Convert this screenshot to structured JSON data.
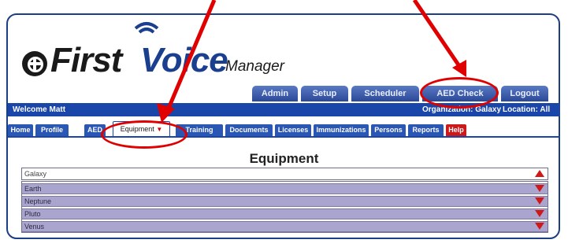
{
  "logo": {
    "first": "First",
    "voice": "Voice",
    "manager": "Manager"
  },
  "nav": {
    "buttons": [
      "Admin",
      "Setup",
      "Scheduler",
      "AED Check",
      "Logout"
    ]
  },
  "status": {
    "welcome": "Welcome Matt",
    "organization": "Organization: Galaxy",
    "location": "Location: All"
  },
  "tabs": [
    "Home",
    "Profile",
    "AED",
    "Equipment",
    "Training",
    "Documents",
    "Licenses",
    "Immunizations",
    "Persons",
    "Reports",
    "Help"
  ],
  "active_tab": "Equipment",
  "main": {
    "title": "Equipment",
    "group": "Galaxy",
    "items": [
      "Earth",
      "Neptune",
      "Pluto",
      "Venus"
    ]
  },
  "colors": {
    "annotation": "#e00000",
    "nav_blue": "#1946a8",
    "row_purple": "#a9a5cf"
  },
  "icons": {
    "collapse": "triangle-up",
    "expand": "triangle-down",
    "dropdown": "chevron-down"
  }
}
